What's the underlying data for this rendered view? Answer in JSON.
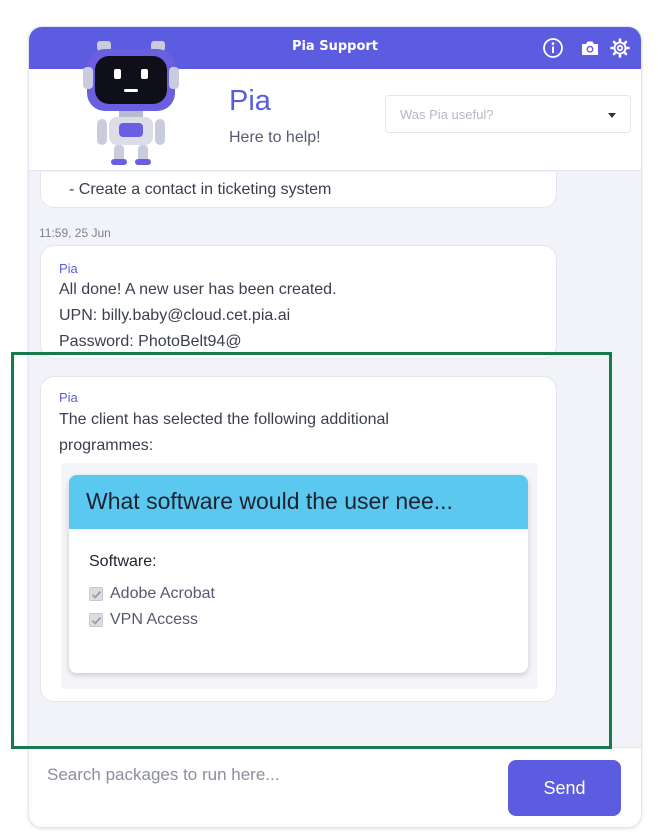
{
  "titlebar": {
    "title": "Pia Support",
    "icons": [
      "info-icon",
      "camera-icon",
      "gear-icon"
    ]
  },
  "header": {
    "bot_name": "Pia",
    "tagline": "Here to help!",
    "feedback": {
      "selected": "Was Pia useful?"
    }
  },
  "messages": [
    {
      "lines": [
        "- Create a contact in ticketing system"
      ]
    },
    {
      "timestamp": "11:59, 25 Jun",
      "sender": "Pia",
      "lines": [
        "All done! A new user has been created.",
        "UPN: billy.baby@cloud.cet.pia.ai",
        "Password: PhotoBelt94@"
      ]
    },
    {
      "sender": "Pia",
      "lines": [
        "The client has selected the following additional",
        "programmes:"
      ],
      "form": {
        "title": "What software would the user nee...",
        "field_label": "Software:",
        "options": [
          {
            "label": "Adobe Acrobat",
            "checked": true
          },
          {
            "label": "VPN Access",
            "checked": true
          }
        ]
      }
    }
  ],
  "composer": {
    "placeholder": "Search packages to run here...",
    "send_label": "Send"
  },
  "colors": {
    "accent": "#5b5ce0",
    "form_header": "#5bc8f0",
    "highlight": "#167a4d"
  }
}
